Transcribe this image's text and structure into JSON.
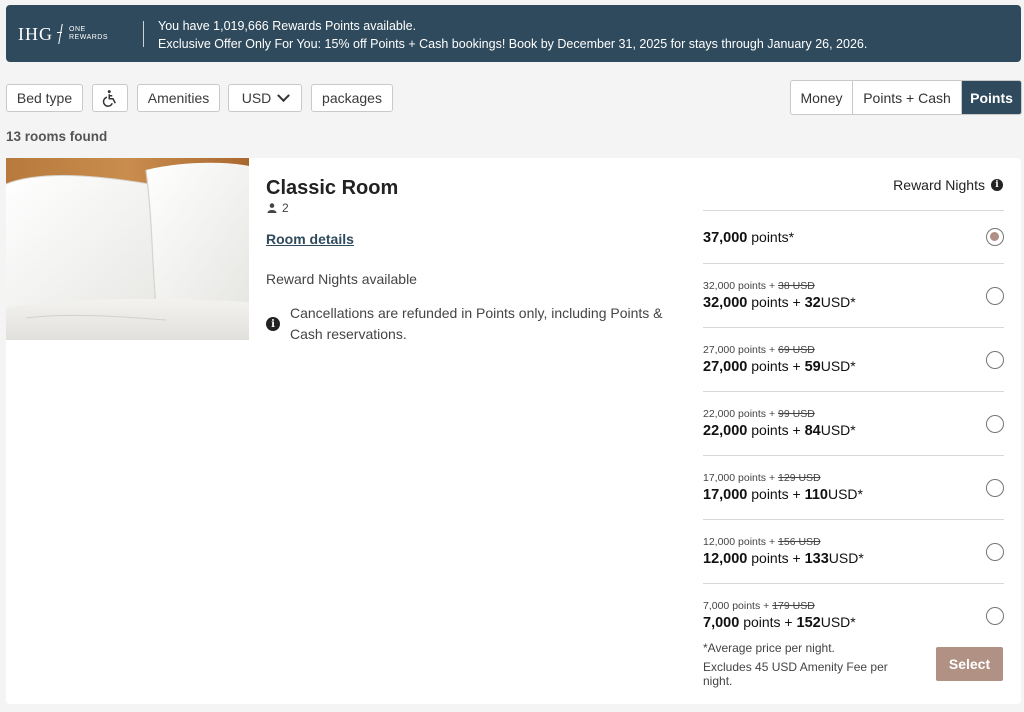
{
  "banner": {
    "logo_text": "IHG",
    "logo_sub_1": "ONE",
    "logo_sub_2": "REWARDS",
    "line1": "You have 1,019,666 Rewards Points available.",
    "line2": "Exclusive Offer Only For You: 15% off Points + Cash bookings! Book by December 31, 2025 for stays through January 26, 2026."
  },
  "filters": {
    "bed_type": "Bed type",
    "accessibility_icon": "accessibility-icon",
    "amenities": "Amenities",
    "currency": "USD",
    "packages": "packages"
  },
  "payment_toggle": {
    "options": [
      "Money",
      "Points + Cash",
      "Points"
    ],
    "selected": "Points"
  },
  "results_count": "13 rooms found",
  "room": {
    "title": "Classic Room",
    "guests": "2",
    "details_link": "Room details",
    "reward_availability": "Reward Nights available",
    "cancellation": "Cancellations are refunded in Points only, including Points & Cash reservations.",
    "rate_header": "Reward Nights",
    "rates": [
      {
        "main_points": "37,000",
        "main_points_label": "points*",
        "selected": true
      },
      {
        "sub_points": "32,000 points +",
        "sub_orig": "38 USD",
        "main_points": "32,000",
        "main_mid": "points +",
        "main_cash": "32",
        "main_cash_label": "USD*"
      },
      {
        "sub_points": "27,000 points +",
        "sub_orig": "69 USD",
        "main_points": "27,000",
        "main_mid": "points +",
        "main_cash": "59",
        "main_cash_label": "USD*"
      },
      {
        "sub_points": "22,000 points +",
        "sub_orig": "99 USD",
        "main_points": "22,000",
        "main_mid": "points +",
        "main_cash": "84",
        "main_cash_label": "USD*"
      },
      {
        "sub_points": "17,000 points +",
        "sub_orig": "129 USD",
        "main_points": "17,000",
        "main_mid": "points +",
        "main_cash": "110",
        "main_cash_label": "USD*"
      },
      {
        "sub_points": "12,000 points +",
        "sub_orig": "156 USD",
        "main_points": "12,000",
        "main_mid": "points +",
        "main_cash": "133",
        "main_cash_label": "USD*"
      },
      {
        "sub_points": "7,000 points +",
        "sub_orig": "179 USD",
        "main_points": "7,000",
        "main_mid": "points +",
        "main_cash": "152",
        "main_cash_label": "USD*"
      }
    ],
    "footnote_1": "*Average price per night.",
    "footnote_2": "Excludes 45 USD Amenity Fee per night.",
    "select_label": "Select"
  },
  "colors": {
    "brand_navy": "#2f4a5c",
    "accent_copper": "#b09183"
  }
}
